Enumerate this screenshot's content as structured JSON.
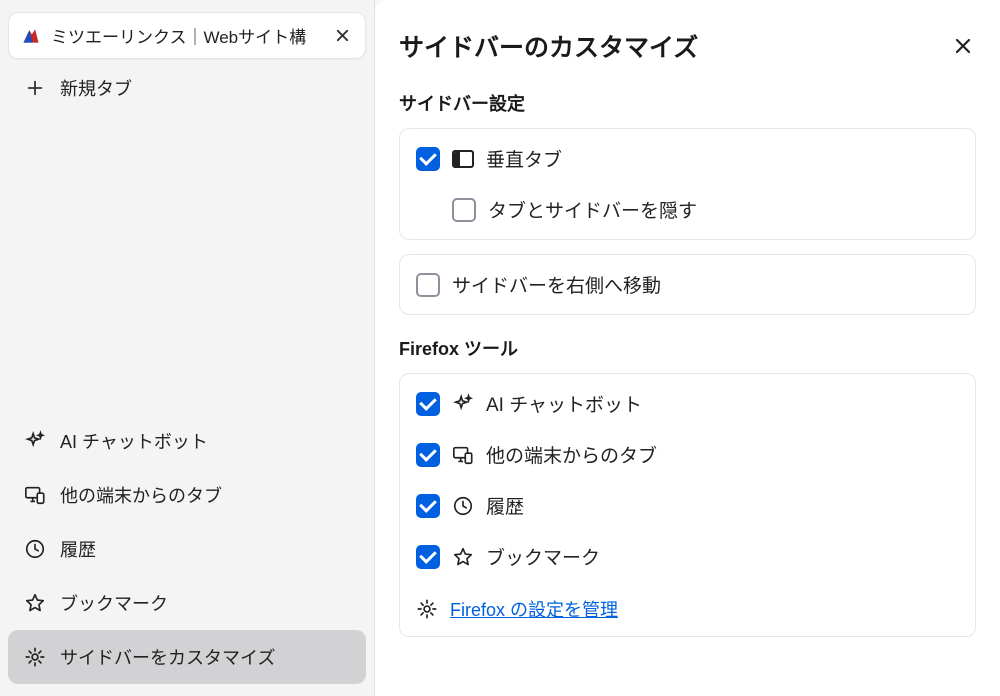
{
  "sidebar": {
    "tab": {
      "title": "ミツエーリンクス｜Webサイト構"
    },
    "new_tab_label": "新規タブ",
    "tools": [
      {
        "label": "AI チャットボット",
        "icon": "sparkles-icon",
        "name": "sidebar-item-ai-chatbot"
      },
      {
        "label": "他の端末からのタブ",
        "icon": "synced-tabs-icon",
        "name": "sidebar-item-synced-tabs"
      },
      {
        "label": "履歴",
        "icon": "history-icon",
        "name": "sidebar-item-history"
      },
      {
        "label": "ブックマーク",
        "icon": "bookmark-icon",
        "name": "sidebar-item-bookmarks"
      },
      {
        "label": "サイドバーをカスタマイズ",
        "icon": "gear-icon",
        "name": "sidebar-item-customize",
        "active": true
      }
    ]
  },
  "panel": {
    "title": "サイドバーのカスタマイズ",
    "section1_title": "サイドバー設定",
    "vertical_tabs_label": "垂直タブ",
    "hide_tabs_label": "タブとサイドバーを隠す",
    "move_right_label": "サイドバーを右側へ移動",
    "section2_title": "Firefox ツール",
    "tools": [
      {
        "label": "AI チャットボット",
        "icon": "sparkles-icon",
        "checked": true
      },
      {
        "label": "他の端末からのタブ",
        "icon": "synced-tabs-icon",
        "checked": true
      },
      {
        "label": "履歴",
        "icon": "history-icon",
        "checked": true
      },
      {
        "label": "ブックマーク",
        "icon": "bookmark-icon",
        "checked": true
      }
    ],
    "settings_link": "Firefox の設定を管理"
  }
}
